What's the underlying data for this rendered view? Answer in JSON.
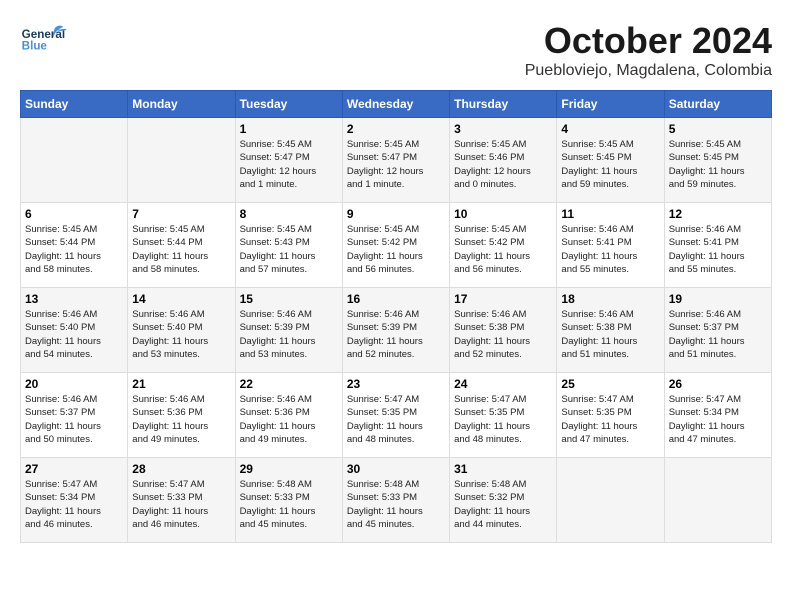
{
  "header": {
    "logo_general": "General",
    "logo_blue": "Blue",
    "month": "October 2024",
    "location": "Puebloviejo, Magdalena, Colombia"
  },
  "weekdays": [
    "Sunday",
    "Monday",
    "Tuesday",
    "Wednesday",
    "Thursday",
    "Friday",
    "Saturday"
  ],
  "weeks": [
    [
      {
        "day": "",
        "info": ""
      },
      {
        "day": "",
        "info": ""
      },
      {
        "day": "1",
        "info": "Sunrise: 5:45 AM\nSunset: 5:47 PM\nDaylight: 12 hours\nand 1 minute."
      },
      {
        "day": "2",
        "info": "Sunrise: 5:45 AM\nSunset: 5:47 PM\nDaylight: 12 hours\nand 1 minute."
      },
      {
        "day": "3",
        "info": "Sunrise: 5:45 AM\nSunset: 5:46 PM\nDaylight: 12 hours\nand 0 minutes."
      },
      {
        "day": "4",
        "info": "Sunrise: 5:45 AM\nSunset: 5:45 PM\nDaylight: 11 hours\nand 59 minutes."
      },
      {
        "day": "5",
        "info": "Sunrise: 5:45 AM\nSunset: 5:45 PM\nDaylight: 11 hours\nand 59 minutes."
      }
    ],
    [
      {
        "day": "6",
        "info": "Sunrise: 5:45 AM\nSunset: 5:44 PM\nDaylight: 11 hours\nand 58 minutes."
      },
      {
        "day": "7",
        "info": "Sunrise: 5:45 AM\nSunset: 5:44 PM\nDaylight: 11 hours\nand 58 minutes."
      },
      {
        "day": "8",
        "info": "Sunrise: 5:45 AM\nSunset: 5:43 PM\nDaylight: 11 hours\nand 57 minutes."
      },
      {
        "day": "9",
        "info": "Sunrise: 5:45 AM\nSunset: 5:42 PM\nDaylight: 11 hours\nand 56 minutes."
      },
      {
        "day": "10",
        "info": "Sunrise: 5:45 AM\nSunset: 5:42 PM\nDaylight: 11 hours\nand 56 minutes."
      },
      {
        "day": "11",
        "info": "Sunrise: 5:46 AM\nSunset: 5:41 PM\nDaylight: 11 hours\nand 55 minutes."
      },
      {
        "day": "12",
        "info": "Sunrise: 5:46 AM\nSunset: 5:41 PM\nDaylight: 11 hours\nand 55 minutes."
      }
    ],
    [
      {
        "day": "13",
        "info": "Sunrise: 5:46 AM\nSunset: 5:40 PM\nDaylight: 11 hours\nand 54 minutes."
      },
      {
        "day": "14",
        "info": "Sunrise: 5:46 AM\nSunset: 5:40 PM\nDaylight: 11 hours\nand 53 minutes."
      },
      {
        "day": "15",
        "info": "Sunrise: 5:46 AM\nSunset: 5:39 PM\nDaylight: 11 hours\nand 53 minutes."
      },
      {
        "day": "16",
        "info": "Sunrise: 5:46 AM\nSunset: 5:39 PM\nDaylight: 11 hours\nand 52 minutes."
      },
      {
        "day": "17",
        "info": "Sunrise: 5:46 AM\nSunset: 5:38 PM\nDaylight: 11 hours\nand 52 minutes."
      },
      {
        "day": "18",
        "info": "Sunrise: 5:46 AM\nSunset: 5:38 PM\nDaylight: 11 hours\nand 51 minutes."
      },
      {
        "day": "19",
        "info": "Sunrise: 5:46 AM\nSunset: 5:37 PM\nDaylight: 11 hours\nand 51 minutes."
      }
    ],
    [
      {
        "day": "20",
        "info": "Sunrise: 5:46 AM\nSunset: 5:37 PM\nDaylight: 11 hours\nand 50 minutes."
      },
      {
        "day": "21",
        "info": "Sunrise: 5:46 AM\nSunset: 5:36 PM\nDaylight: 11 hours\nand 49 minutes."
      },
      {
        "day": "22",
        "info": "Sunrise: 5:46 AM\nSunset: 5:36 PM\nDaylight: 11 hours\nand 49 minutes."
      },
      {
        "day": "23",
        "info": "Sunrise: 5:47 AM\nSunset: 5:35 PM\nDaylight: 11 hours\nand 48 minutes."
      },
      {
        "day": "24",
        "info": "Sunrise: 5:47 AM\nSunset: 5:35 PM\nDaylight: 11 hours\nand 48 minutes."
      },
      {
        "day": "25",
        "info": "Sunrise: 5:47 AM\nSunset: 5:35 PM\nDaylight: 11 hours\nand 47 minutes."
      },
      {
        "day": "26",
        "info": "Sunrise: 5:47 AM\nSunset: 5:34 PM\nDaylight: 11 hours\nand 47 minutes."
      }
    ],
    [
      {
        "day": "27",
        "info": "Sunrise: 5:47 AM\nSunset: 5:34 PM\nDaylight: 11 hours\nand 46 minutes."
      },
      {
        "day": "28",
        "info": "Sunrise: 5:47 AM\nSunset: 5:33 PM\nDaylight: 11 hours\nand 46 minutes."
      },
      {
        "day": "29",
        "info": "Sunrise: 5:48 AM\nSunset: 5:33 PM\nDaylight: 11 hours\nand 45 minutes."
      },
      {
        "day": "30",
        "info": "Sunrise: 5:48 AM\nSunset: 5:33 PM\nDaylight: 11 hours\nand 45 minutes."
      },
      {
        "day": "31",
        "info": "Sunrise: 5:48 AM\nSunset: 5:32 PM\nDaylight: 11 hours\nand 44 minutes."
      },
      {
        "day": "",
        "info": ""
      },
      {
        "day": "",
        "info": ""
      }
    ]
  ]
}
